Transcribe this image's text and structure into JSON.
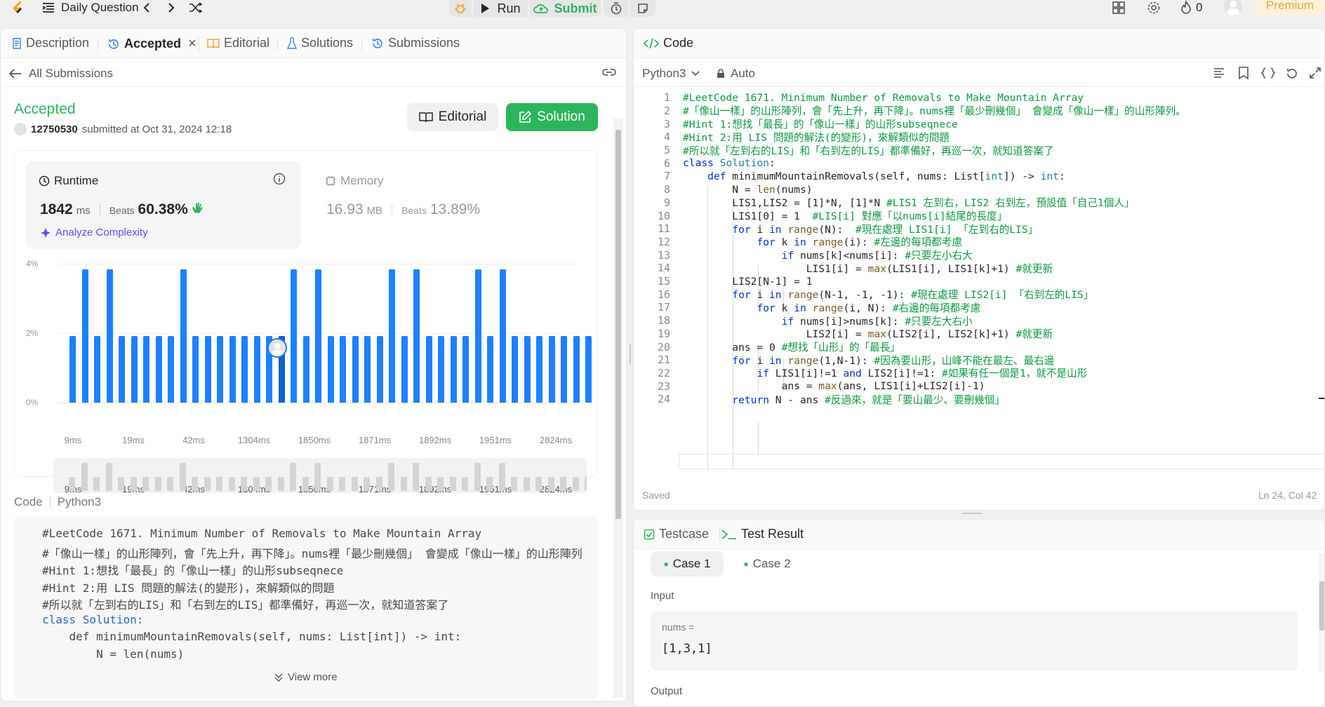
{
  "topbar": {
    "title": "Daily Question",
    "run_label": "Run",
    "submit_label": "Submit",
    "streak_count": "0",
    "premium_label": "Premium"
  },
  "left_tabs": {
    "description": "Description",
    "accepted": "Accepted",
    "editorial": "Editorial",
    "solutions": "Solutions",
    "submissions": "Submissions"
  },
  "submission": {
    "back_label": "All Submissions",
    "status": "Accepted",
    "user": "12750530",
    "submitted_text": "submitted at Oct 31, 2024 12:18",
    "editorial_btn": "Editorial",
    "solution_btn": "Solution",
    "runtime_label": "Runtime",
    "runtime_value": "1842",
    "runtime_unit": "ms",
    "beats_label": "Beats",
    "runtime_beats": "60.38%",
    "analyze_label": "Analyze Complexity",
    "memory_label": "Memory",
    "memory_value": "16.93",
    "memory_unit": "MB",
    "memory_beats": "13.89%"
  },
  "chart_data": {
    "type": "bar",
    "y_ticks": [
      "4%",
      "2%",
      "0%"
    ],
    "ylim": [
      0,
      4
    ],
    "x_tick_labels": [
      "9ms",
      "19ms",
      "42ms",
      "1304ms",
      "1850ms",
      "1871ms",
      "1892ms",
      "1951ms",
      "2824ms"
    ],
    "values": [
      2,
      4,
      2,
      4,
      2,
      2,
      2,
      2,
      2,
      4,
      2,
      2,
      2,
      2,
      2,
      2,
      2,
      2,
      4,
      2,
      4,
      2,
      2,
      2,
      2,
      2,
      4,
      2,
      4,
      2,
      2,
      2,
      2,
      4,
      2,
      4,
      2,
      2,
      2,
      2,
      2,
      2,
      2
    ],
    "highlight_index": 17,
    "grid": true
  },
  "code_section": {
    "label": "Code",
    "lang": "Python3",
    "view_more": "View more",
    "preview_lines": [
      "#LeetCode 1671. Minimum Number of Removals to Make Mountain Array",
      "#「像山一樣」的山形陣列，會「先上升，再下降」。nums裡「最少刪幾個」 會變成「像山一樣」的山形陣列",
      "#Hint 1:想找「最長」的「像山一樣」的山形subseqnece",
      "#Hint 2:用 LIS 問題的解法(的變形)，來解類似的問題",
      "#所以就「左到右的LIS」和「右到左的LIS」都準備好，再巡一次，就知道答案了"
    ]
  },
  "editor": {
    "title": "Code",
    "language": "Python3",
    "auto_label": "Auto",
    "saved_label": "Saved",
    "cursor_pos": "Ln 24, Col 42",
    "lines": [
      "#LeetCode 1671. Minimum Number of Removals to Make Mountain Array",
      "#「像山一樣」的山形陣列，會「先上升，再下降」。nums裡「最少刪幾個」 會變成「像山一樣」的山形陣列。",
      "#Hint 1:想找「最長」的「像山一樣」的山形subseqnece",
      "#Hint 2:用 LIS 問題的解法(的變形)，來解類似的問題",
      "#所以就「左到右的LIS」和「右到左的LIS」都準備好，再巡一次，就知道答案了",
      "class Solution:",
      "    def minimumMountainRemovals(self, nums: List[int]) -> int:",
      "        N = len(nums)",
      "        LIS1,LIS2 = [1]*N, [1]*N #LIS1 左到右，LIS2 右到左，預設值「自己1個人」",
      "        LIS1[0] = 1  #LIS[i] 對應「以nums[i]結尾的長度」",
      "        for i in range(N):  #現在處理 LIS1[i] 「左到右的LIS」",
      "            for k in range(i): #左邊的每項都考慮",
      "                if nums[k]<nums[i]: #只要左小右大",
      "                    LIS1[i] = max(LIS1[i], LIS1[k]+1) #就更新",
      "        LIS2[N-1] = 1",
      "        for i in range(N-1, -1, -1): #現在處理 LIS2[i] 「右到左的LIS」",
      "            for k in range(i, N): #右邊的每項都考慮",
      "                if nums[i]>nums[k]: #只要左大右小",
      "                    LIS2[i] = max(LIS2[i], LIS2[k]+1) #就更新",
      "        ans = 0 #想找「山形」的「最長」",
      "        for i in range(1,N-1): #因為要山形，山峰不能在最左、最右邊",
      "            if LIS1[i]!=1 and LIS2[i]!=1: #如果有任一個是1，就不是山形",
      "                ans = max(ans, LIS1[i]+LIS2[i]-1)",
      "        return N - ans #反過來，就是「要山最少、要刪幾個」"
    ]
  },
  "testpanel": {
    "testcase_tab": "Testcase",
    "result_tab": "Test Result",
    "case1": "Case 1",
    "case2": "Case 2",
    "input_label": "Input",
    "var_name": "nums =",
    "var_value": "[1,3,1]",
    "output_label": "Output"
  },
  "colors": {
    "accent_green": "#2db55d",
    "bar_blue": "#1e80ff",
    "comment_green": "#0c9a41",
    "keyword_blue": "#0033d6",
    "premium_bg": "#fdf1dc",
    "premium_text": "#e8a53a"
  }
}
